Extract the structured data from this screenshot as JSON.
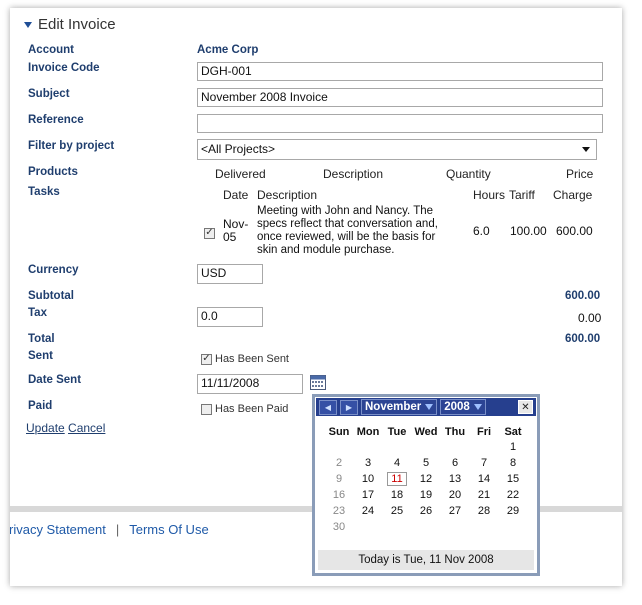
{
  "section_title": "Edit Invoice",
  "labels": {
    "account": "Account",
    "invoice_code": "Invoice Code",
    "subject": "Subject",
    "reference": "Reference",
    "filter_by_project": "Filter by project",
    "products": "Products",
    "tasks": "Tasks",
    "currency": "Currency",
    "subtotal": "Subtotal",
    "tax": "Tax",
    "total": "Total",
    "sent": "Sent",
    "date_sent": "Date Sent",
    "paid": "Paid"
  },
  "values": {
    "account": "Acme Corp",
    "invoice_code": "DGH-001",
    "subject": "November 2008 Invoice",
    "reference": "",
    "project_filter": "<All Projects>",
    "currency": "USD",
    "subtotal": "600.00",
    "tax_rate": "0.0",
    "tax_amount": "0.00",
    "total": "600.00",
    "date_sent": "11/11/2008"
  },
  "products_headers": [
    "Delivered",
    "Description",
    "Quantity",
    "Price"
  ],
  "tasks_headers": {
    "date": "Date",
    "description": "Description",
    "hours": "Hours",
    "tariff": "Tariff",
    "charge": "Charge"
  },
  "task_rows": [
    {
      "checked": true,
      "date_line1": "Nov-",
      "date_line2": "05",
      "description_lines": [
        "Meeting with John and Nancy. The",
        "specs reflect that conversation and,",
        "once reviewed, will be the basis for",
        "skin and module purchase."
      ],
      "hours": "6.0",
      "tariff": "100.00",
      "charge": "600.00"
    }
  ],
  "sent_checkbox": {
    "label": "Has Been Sent",
    "checked": true
  },
  "paid_checkbox": {
    "label": "Has Been Paid",
    "checked": false
  },
  "actions": {
    "update": "Update",
    "cancel": "Cancel"
  },
  "footer": {
    "privacy": "rivacy Statement",
    "separator": "|",
    "terms": "Terms Of Use"
  },
  "calendar": {
    "month": "November",
    "year": "2008",
    "prev_glyph": "◀",
    "next_glyph": "▶",
    "close_glyph": "✕",
    "weekdays": [
      "Sun",
      "Mon",
      "Tue",
      "Wed",
      "Thu",
      "Fri",
      "Sat"
    ],
    "weeks": [
      [
        "",
        "",
        "",
        "",
        "",
        "",
        "1"
      ],
      [
        "2",
        "3",
        "4",
        "5",
        "6",
        "7",
        "8"
      ],
      [
        "9",
        "10",
        "11",
        "12",
        "13",
        "14",
        "15"
      ],
      [
        "16",
        "17",
        "18",
        "19",
        "20",
        "21",
        "22"
      ],
      [
        "23",
        "24",
        "25",
        "26",
        "27",
        "28",
        "29"
      ],
      [
        "30",
        "",
        "",
        "",
        "",
        "",
        ""
      ]
    ],
    "today_day": "11",
    "footer_text": "Today is Tue, 11 Nov 2008"
  },
  "colors": {
    "label_blue": "#1f3e6e",
    "calendar_header": "#263f8e",
    "today_red": "#cc0000"
  },
  "icons": {
    "collapse": "triangle-down-icon",
    "calendar": "calendar-icon",
    "dropdown": "chevron-down-icon"
  }
}
